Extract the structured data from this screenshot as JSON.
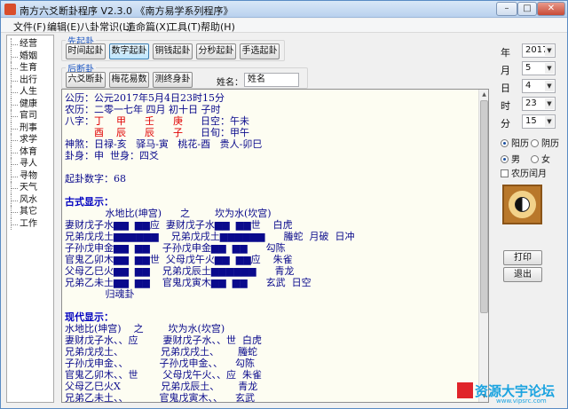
{
  "window": {
    "title": "南方六爻断卦程序 V2.3.0 《南方易学系列程序》"
  },
  "menu": [
    "文件(F)",
    "编辑(E)",
    "八卦常识(L)",
    "造命篇(X)",
    "工具(T)",
    "帮助(H)"
  ],
  "sidebar": [
    "经营",
    "婚姻",
    "生育",
    "出行",
    "人生",
    "健康",
    "官司",
    "刑事",
    "求学",
    "体育",
    "寻人",
    "寻物",
    "天气",
    "风水",
    "其它",
    "工作"
  ],
  "qigua": {
    "first_label": "先起卦",
    "buttons": [
      "时间起卦",
      "数字起卦",
      "铜钱起卦",
      "分秒起卦",
      "手选起卦"
    ],
    "selected": "数字起卦"
  },
  "duangua": {
    "label": "后断卦",
    "buttons": [
      "六爻断卦",
      "梅花易数",
      "测终身卦"
    ],
    "name_label": "姓名：",
    "name_value": "姓名"
  },
  "date": {
    "year_label": "年",
    "year": "2017",
    "month_label": "月",
    "month": "5",
    "day_label": "日",
    "day": "4",
    "hour_label": "时",
    "hour": "23",
    "minute_label": "分",
    "minute": "15"
  },
  "options": {
    "solar": "阳历",
    "lunar": "阴历",
    "calendar_selected": "阳历",
    "male": "男",
    "female": "女",
    "gender_selected": "男",
    "leap_month": "农历闰月"
  },
  "actions": {
    "print": "打印",
    "exit": "退出"
  },
  "watermark": {
    "main": "资源大宇论坛",
    "sub": "www.vipsrc.com"
  },
  "result": {
    "gongli": "公历：公元2017年5月4日23时15分",
    "nongli": "农历：二零一七年 四月 初十日 子时",
    "bazi_label": "八字：",
    "bazi_gan": [
      "丁",
      "甲",
      "壬",
      "庚"
    ],
    "bazi_zhi": [
      "酉",
      "辰",
      "辰",
      "子"
    ],
    "rikong": "日空：午未",
    "xunkong": "日旬：甲午",
    "shensha": "神煞：日禄-亥   驿马-寅   桃花-酉   贵人-卯巳",
    "guashen": "卦身：申  世身：四爻",
    "qigua_num": "起卦数字：68",
    "gushi_heading": "古式显示：",
    "gushi_title": "             水地比(坤宫)      之        坎为水(坎宫)",
    "gushi_lines": [
      "妻财戊子水▆▆  ▆▆应  妻财戊子水▆▆  ▆▆世    白虎",
      "兄弟戊戌土▆▆▆▆▆▆    兄弟戊戌土▆▆▆▆▆▆      螣蛇  月破  日冲",
      "子孙戊申金▆▆  ▆▆    子孙戊申金▆▆  ▆▆      勾陈",
      "官鬼乙卯木▆▆  ▆▆世  父母戊午火▆▆  ▆▆应    朱雀",
      "父母乙巳火▆▆  ▆▆    兄弟戊辰土▆▆▆▆▆▆      青龙",
      "兄弟乙未土▆▆  ▆▆    官鬼戊寅木▆▆  ▆▆      玄武  日空"
    ],
    "gushi_footer": "             归魂卦",
    "xiandai_heading": "现代显示：",
    "xiandai_title": "水地比(坤宫)    之        坎为水(坎宫)",
    "xiandai_lines": [
      "妻财戊子水、、应        妻财戊子水、、世  白虎",
      "兄弟戊戌土、            兄弟戊戌土、      螣蛇",
      "子孙戊申金、、          子孙戊申金、、    勾陈",
      "官鬼乙卯木、、世        父母戊午火、、应  朱雀",
      "父母乙巳火X             兄弟戊辰土、      青龙",
      "兄弟乙未土、、          官鬼戊寅木、、    玄武"
    ]
  }
}
